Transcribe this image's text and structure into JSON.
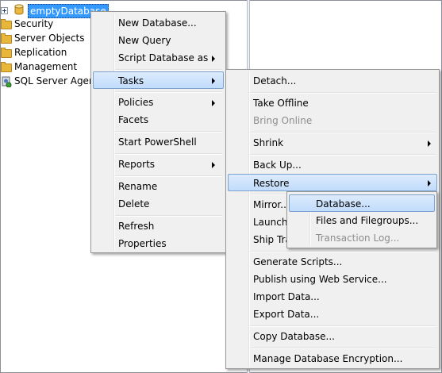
{
  "tree": {
    "database": "emptyDatabase",
    "items": [
      "Security",
      "Server Objects",
      "Replication",
      "Management",
      "SQL Server Agent"
    ]
  },
  "context_menu": {
    "items": [
      "New Database...",
      "New Query",
      "Script Database as",
      "Tasks",
      "Policies",
      "Facets",
      "Start PowerShell",
      "Reports",
      "Rename",
      "Delete",
      "Refresh",
      "Properties"
    ]
  },
  "tasks_menu": {
    "items": [
      "Detach...",
      "Take Offline",
      "Bring Online",
      "Shrink",
      "Back Up...",
      "Restore",
      "Mirror...",
      "Launch",
      "Ship Tra",
      "Generate Scripts...",
      "Publish using Web Service...",
      "Import Data...",
      "Export Data...",
      "Copy Database...",
      "Manage Database Encryption..."
    ]
  },
  "restore_menu": {
    "items": [
      "Database...",
      "Files and Filegroups...",
      "Transaction Log..."
    ]
  },
  "colors": {
    "selection": "#3399ff",
    "menu_bg": "#f0f0f0",
    "highlight_border": "#7da2ce"
  }
}
